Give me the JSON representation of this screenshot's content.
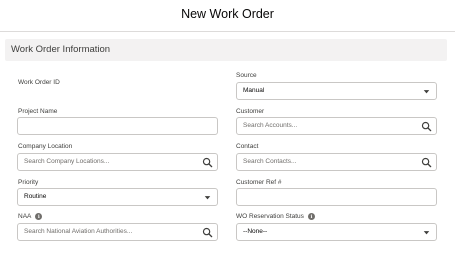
{
  "modal": {
    "title": "New Work Order"
  },
  "section": {
    "title": "Work Order Information"
  },
  "fields": {
    "work_order_id": {
      "label": "Work Order ID"
    },
    "source": {
      "label": "Source",
      "value": "Manual"
    },
    "project_name": {
      "label": "Project Name",
      "value": ""
    },
    "customer": {
      "label": "Customer",
      "placeholder": "Search Accounts..."
    },
    "company_location": {
      "label": "Company Location",
      "placeholder": "Search Company Locations..."
    },
    "contact": {
      "label": "Contact",
      "placeholder": "Search Contacts..."
    },
    "priority": {
      "label": "Priority",
      "value": "Routine"
    },
    "customer_ref": {
      "label": "Customer Ref #",
      "value": ""
    },
    "naa": {
      "label": "NAA",
      "placeholder": "Search National Aviation Authorities..."
    },
    "wo_reservation_status": {
      "label": "WO Reservation Status",
      "value": "--None--"
    }
  }
}
